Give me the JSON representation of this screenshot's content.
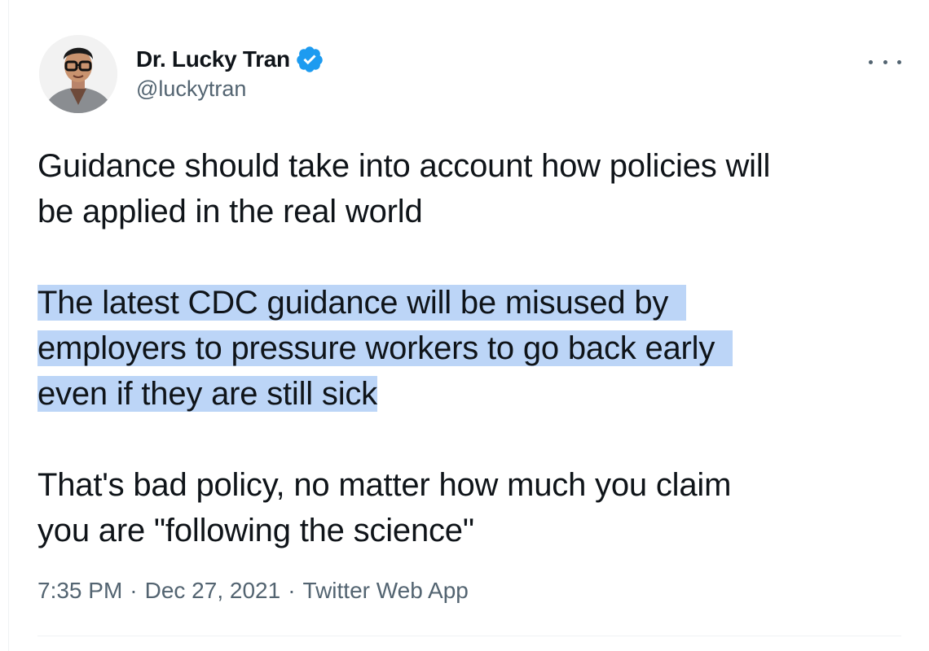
{
  "author": {
    "display_name": "Dr. Lucky Tran",
    "handle": "@luckytran",
    "verified": true,
    "avatar_icon": "profile-photo-icon"
  },
  "tweet": {
    "paragraph1": {
      "lines": [
        "Guidance should take into account how policies will",
        "be applied in the real world"
      ]
    },
    "paragraph2": {
      "highlighted": true,
      "lines": [
        "The latest CDC guidance will be misused by",
        "employers to pressure workers to go back early",
        "even if they are still sick"
      ]
    },
    "paragraph3": {
      "lines": [
        "That's bad policy, no matter how much you claim",
        "you are \"following the science\""
      ]
    }
  },
  "meta": {
    "time": "7:35 PM",
    "separator": "·",
    "date": "Dec 27, 2021",
    "source": "Twitter Web App"
  },
  "colors": {
    "text": "#0f1419",
    "secondary": "#536471",
    "verified_badge": "#1d9bf0",
    "selection_highlight": "#bcd5f7"
  }
}
